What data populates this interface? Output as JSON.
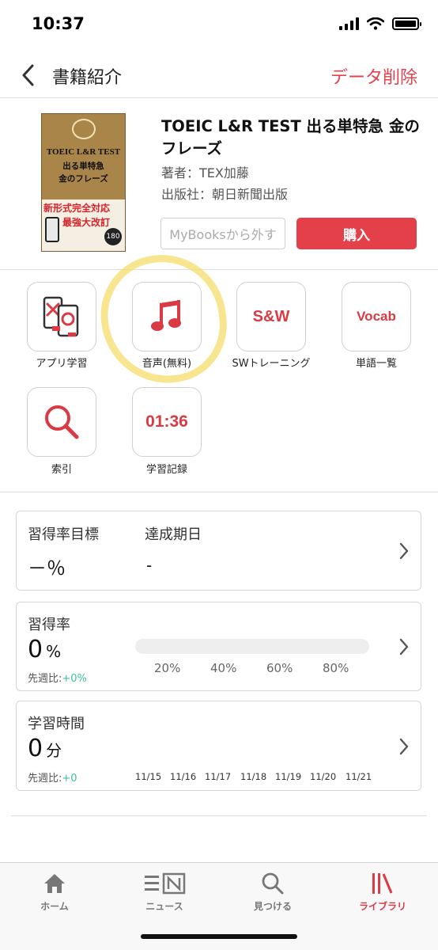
{
  "status_bar": {
    "time": "10:37"
  },
  "nav": {
    "title": "書籍紹介",
    "delete_label": "データ削除"
  },
  "book": {
    "title": "TOEIC L&R TEST 出る単特急 金のフレーズ",
    "author": "著者：TEX加藤",
    "publisher": "出版社：朝日新聞出版",
    "remove_label": "MyBooksから外す",
    "buy_label": "購入",
    "cover": {
      "line1": "TOEIC L&R TEST",
      "line2": "出る単特急",
      "line3": "金のフレーズ",
      "band1": "新形式完全対応",
      "band2": "最強大改訂",
      "badge": "180"
    }
  },
  "features": [
    {
      "label": "アプリ学習",
      "icon": "flashcards-icon"
    },
    {
      "label": "音声(無料)",
      "icon": "music-note-icon"
    },
    {
      "label": "SWトレーニング",
      "icon_text": "S&W"
    },
    {
      "label": "単語一覧",
      "icon_text": "Vocab"
    },
    {
      "label": "索引",
      "icon": "search-icon"
    },
    {
      "label": "学習記録",
      "icon_text": "01:36"
    }
  ],
  "goal_card": {
    "goal_label": "習得率目標",
    "goal_value": "－％",
    "deadline_label": "達成期日",
    "deadline_value": "-"
  },
  "mastery_card": {
    "label": "習得率",
    "value": "0",
    "unit": "%",
    "week_label": "先週比:",
    "week_value": "+0%",
    "progress": 0,
    "ticks": [
      "20%",
      "40%",
      "60%",
      "80%"
    ]
  },
  "time_card": {
    "label": "学習時間",
    "value": "0",
    "unit": "分",
    "week_label": "先週比:",
    "week_value": "+0",
    "dates": [
      "11/15",
      "11/16",
      "11/17",
      "11/18",
      "11/19",
      "11/20",
      "11/21"
    ]
  },
  "tabs": [
    {
      "label": "ホーム",
      "icon": "home-icon"
    },
    {
      "label": "ニュース",
      "icon": "news-icon"
    },
    {
      "label": "見つける",
      "icon": "search-icon"
    },
    {
      "label": "ライブラリ",
      "icon": "library-icon"
    }
  ],
  "colors": {
    "accent": "#e3404a",
    "green": "#3cbfa0",
    "highlight": "#f6dc69"
  }
}
